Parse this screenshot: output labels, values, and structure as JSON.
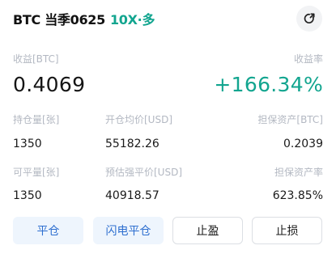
{
  "header": {
    "symbol": "BTC 当季0625",
    "leverage": "10X·多",
    "share_icon": "share-arrow-icon"
  },
  "pnl": {
    "label": "收益[BTC]",
    "value": "0.4069"
  },
  "roe": {
    "label": "收益率",
    "value": "+166.34%"
  },
  "row1": {
    "position_label": "持仓量[张]",
    "position_value": "1350",
    "avg_price_label": "开仓均价[USD]",
    "avg_price_value": "55182.26",
    "margin_label": "担保资产[BTC]",
    "margin_value": "0.2039"
  },
  "row2": {
    "closable_label": "可平量[张]",
    "closable_value": "1350",
    "liq_price_label": "预估强平价[USD]",
    "liq_price_value": "40918.57",
    "margin_ratio_label": "担保资产率",
    "margin_ratio_value": "623.85%"
  },
  "actions": {
    "close_label": "平仓",
    "flash_close_label": "闪电平仓",
    "take_profit_label": "止盈",
    "stop_loss_label": "止损"
  },
  "colors": {
    "long_green": "#12a58f",
    "accent_blue": "#2e6fd0",
    "label_gray": "#b3b8c2"
  }
}
